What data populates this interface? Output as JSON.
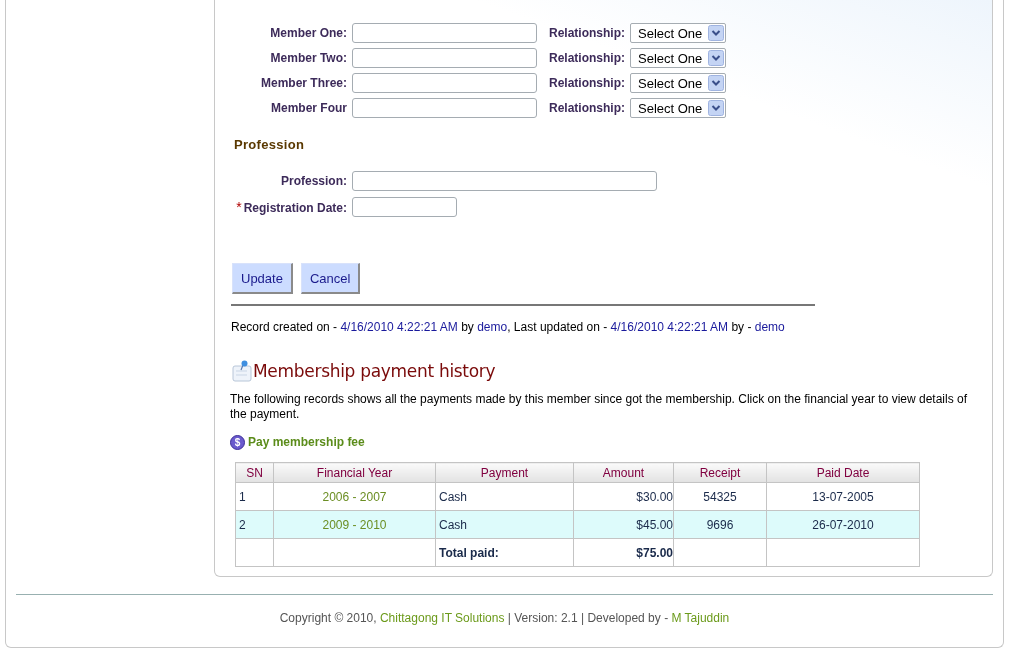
{
  "family_members": [
    {
      "label": "Member One:",
      "relationship_label": "Relationship:",
      "relationship_value": "Select One"
    },
    {
      "label": "Member Two:",
      "relationship_label": "Relationship:",
      "relationship_value": "Select One"
    },
    {
      "label": "Member Three:",
      "relationship_label": "Relationship:",
      "relationship_value": "Select One"
    },
    {
      "label": "Member Four",
      "relationship_label": "Relationship:",
      "relationship_value": "Select One"
    }
  ],
  "profession": {
    "heading": "Profession",
    "required_mark": "*",
    "fields": [
      {
        "label": "Profession:",
        "required": false,
        "kind": "wide"
      },
      {
        "label": "Registration Date:",
        "required": true,
        "kind": "short"
      }
    ]
  },
  "buttons": [
    "Update",
    "Cancel"
  ],
  "record_info": [
    {
      "kind": "text",
      "text": "Record created on - "
    },
    {
      "kind": "link",
      "text": "4/16/2010 4:22:21 AM"
    },
    {
      "kind": "text",
      "text": " by "
    },
    {
      "kind": "link",
      "text": "demo"
    },
    {
      "kind": "text",
      "text": ", Last updated on - "
    },
    {
      "kind": "link",
      "text": "4/16/2010 4:22:21 AM"
    },
    {
      "kind": "text",
      "text": " by - "
    },
    {
      "kind": "link",
      "text": "demo"
    }
  ],
  "payment_history": {
    "title": "Membership payment history",
    "description": "The following records shows all the payments made by this member since got the membership. Click on the financial year to view details of the payment.",
    "pay_link": {
      "icon": "$",
      "label": "Pay membership fee"
    },
    "table": {
      "columns": [
        "SN",
        "Financial Year",
        "Payment",
        "Amount",
        "Receipt",
        "Paid Date"
      ],
      "rows": [
        [
          "1",
          "2006 - 2007",
          "Cash",
          "$30.00",
          "54325",
          "13-07-2005"
        ],
        [
          "2",
          "2009 - 2010",
          "Cash",
          "$45.00",
          "9696",
          "26-07-2010"
        ]
      ],
      "total": {
        "label": "Total paid:",
        "value": "$75.00"
      }
    }
  },
  "footer": [
    {
      "kind": "text",
      "text": "Copyright © 2010, "
    },
    {
      "kind": "link",
      "text": "Chittagong IT Solutions"
    },
    {
      "kind": "text",
      "text": " | Version: 2.1 | Developed by - "
    },
    {
      "kind": "link",
      "text": "M Tajuddin"
    }
  ]
}
